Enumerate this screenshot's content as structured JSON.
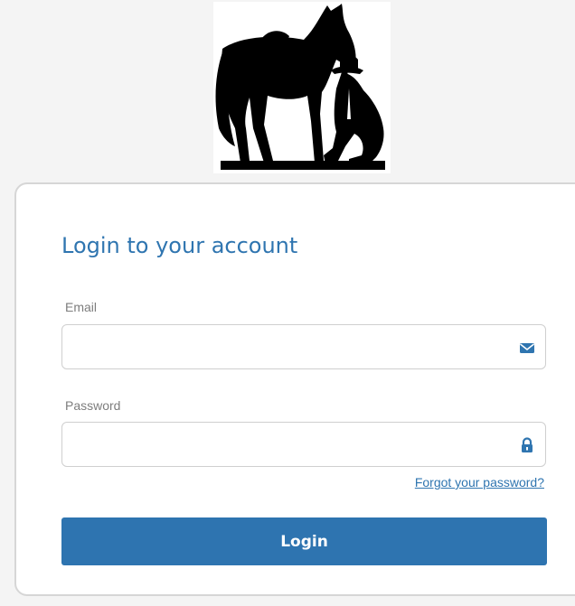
{
  "logo": {
    "icon": "horse-and-cowboy-silhouette-logo"
  },
  "login": {
    "title": "Login to your account",
    "email": {
      "label": "Email",
      "value": "",
      "placeholder": "",
      "icon": "envelope-icon"
    },
    "password": {
      "label": "Password",
      "value": "",
      "placeholder": "",
      "icon": "lock-icon"
    },
    "forgot_password": "Forgot your password?",
    "submit_label": "Login"
  },
  "colors": {
    "accent": "#2f75b0",
    "button": "#2e74b0",
    "page_background": "#f4f4f4",
    "card_border": "#d6d6d6"
  }
}
